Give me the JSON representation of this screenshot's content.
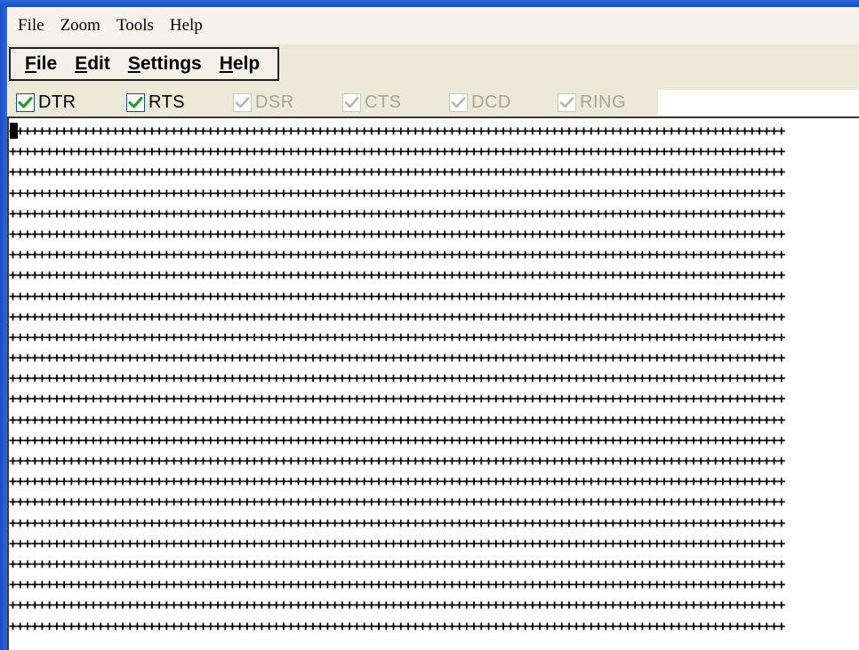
{
  "outer_menu": [
    "File",
    "Zoom",
    "Tools",
    "Help"
  ],
  "inner_menu": [
    {
      "access": "F",
      "rest": "ile"
    },
    {
      "access": "E",
      "rest": "dit"
    },
    {
      "access": "S",
      "rest": "ettings"
    },
    {
      "access": "H",
      "rest": "elp"
    }
  ],
  "signals": [
    {
      "label": "DTR",
      "checked": true,
      "enabled": true
    },
    {
      "label": "RTS",
      "checked": true,
      "enabled": true
    },
    {
      "label": "DSR",
      "checked": true,
      "enabled": false
    },
    {
      "label": "CTS",
      "checked": true,
      "enabled": false
    },
    {
      "label": "DCD",
      "checked": true,
      "enabled": false
    },
    {
      "label": "RING",
      "checked": true,
      "enabled": false
    }
  ],
  "terminal": {
    "fill_char": "+",
    "line_count": 25,
    "chars_per_line": 106
  },
  "colors": {
    "window_frame": "#1a4fc6",
    "check_green": "#21a121",
    "check_disabled": "#b8b6a8",
    "disabled_text": "#a7a69b"
  }
}
